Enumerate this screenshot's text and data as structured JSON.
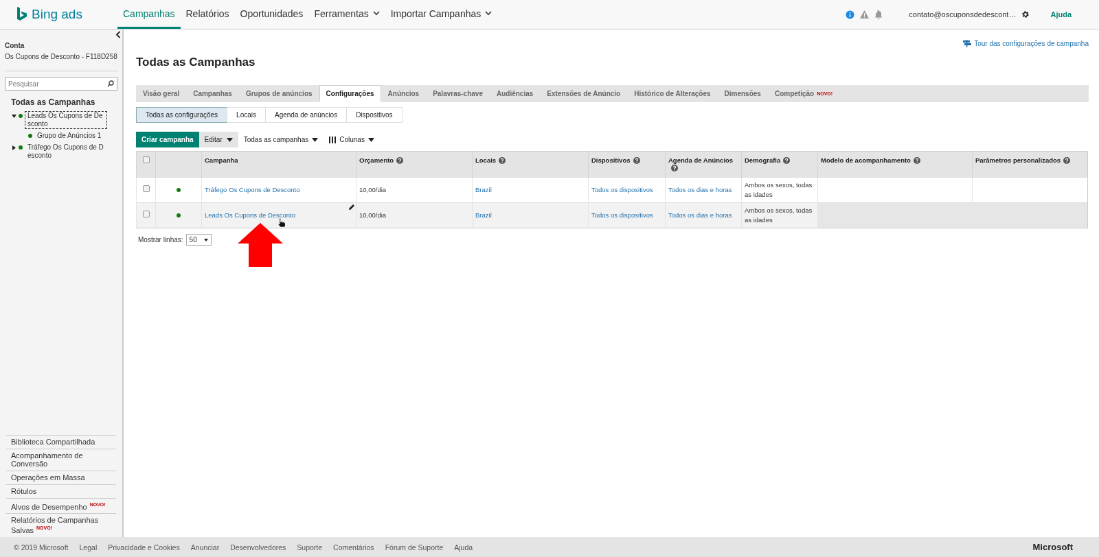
{
  "brand": "Bing ads",
  "nav": [
    {
      "label": "Campanhas",
      "selected": true,
      "dropdown": false
    },
    {
      "label": "Relatórios",
      "selected": false,
      "dropdown": false
    },
    {
      "label": "Oportunidades",
      "selected": false,
      "dropdown": false
    },
    {
      "label": "Ferramentas",
      "selected": false,
      "dropdown": true
    },
    {
      "label": "Importar Campanhas",
      "selected": false,
      "dropdown": true
    }
  ],
  "account_email": "contato@oscuponsdedescont…",
  "help": "Ajuda",
  "sidebar": {
    "account_label": "Conta",
    "account_name": "Os Cupons de Desconto - F118D258",
    "search_placeholder": "Pesquisar",
    "tree_title": "Todas as Campanhas",
    "tree": [
      {
        "label": "Leads Os Cupons de Desconto",
        "expanded": true,
        "focused": true,
        "children": [
          {
            "label": "Grupo de Anúncios 1"
          }
        ]
      },
      {
        "label": "Tráfego Os Cupons de Desconto",
        "expanded": false,
        "focused": false
      }
    ],
    "links": [
      {
        "label": "Biblioteca Compartilhada"
      },
      {
        "label": "Acompanhamento de Conversão"
      },
      {
        "label": "Operações em Massa"
      },
      {
        "label": "Rótulos"
      },
      {
        "label": "Alvos de Desempenho",
        "badge": "NOVO!"
      },
      {
        "label": "Relatórios de Campanhas Salvas",
        "badge": "NOVO!"
      }
    ]
  },
  "page_title": "Todas as Campanhas",
  "tour_link": "Tour das configurações de campanha",
  "tabs": [
    {
      "label": "Visão geral",
      "selected": false
    },
    {
      "label": "Campanhas",
      "selected": false
    },
    {
      "label": "Grupos de anúncios",
      "selected": false
    },
    {
      "label": "Configurações",
      "selected": true
    },
    {
      "label": "Anúncios",
      "selected": false
    },
    {
      "label": "Palavras-chave",
      "selected": false
    },
    {
      "label": "Audiências",
      "selected": false
    },
    {
      "label": "Extensões de Anúncio",
      "selected": false
    },
    {
      "label": "Histórico de Alterações",
      "selected": false
    },
    {
      "label": "Dimensões",
      "selected": false
    },
    {
      "label": "Competição",
      "selected": false,
      "badge": "NOVO!"
    }
  ],
  "subtabs": [
    {
      "label": "Todas as configurações",
      "selected": true
    },
    {
      "label": "Locais",
      "selected": false
    },
    {
      "label": "Agenda de anúncios",
      "selected": false
    },
    {
      "label": "Dispositivos",
      "selected": false
    }
  ],
  "toolbar": {
    "create": "Criar campanha",
    "edit": "Editar",
    "filter": "Todas as campanhas",
    "columns": "Colunas"
  },
  "table": {
    "select_all_checked": false,
    "columns": [
      {
        "label": "Campanha",
        "help": false
      },
      {
        "label": "Orçamento",
        "help": true
      },
      {
        "label": "Locais",
        "help": true
      },
      {
        "label": "Dispositivos",
        "help": true
      },
      {
        "label": "Agenda de Anúncios",
        "help": true
      },
      {
        "label": "Demografia",
        "help": true
      },
      {
        "label": "Modelo de acompanhamento",
        "help": true
      },
      {
        "label": "Parâmetros personalizados",
        "help": true
      }
    ],
    "rows": [
      {
        "checked": false,
        "highlighted": false,
        "cells": [
          "Tráfego Os Cupons de Desconto",
          "10,00/dia",
          "Brazil",
          "Todos os dispositivos",
          "Todos os dias e horas",
          "Ambos os sexos, todas as idades"
        ]
      },
      {
        "checked": false,
        "highlighted": true,
        "cells": [
          "Leads Os Cupons de Desconto",
          "10,00/dia",
          "Brazil",
          "Todos os dispositivos",
          "Todos os dias e horas",
          "Ambos os sexos, todas as idades"
        ]
      }
    ]
  },
  "rows_label": "Mostrar linhas:",
  "rows_value": "50",
  "footer": {
    "links": [
      "© 2019 Microsoft",
      "Legal",
      "Privacidade e Cookies",
      "Anunciar",
      "Desenvolvedores",
      "Suporte",
      "Comentários",
      "Fórum de Suporte",
      "Ajuda"
    ],
    "brand": "Microsoft"
  }
}
